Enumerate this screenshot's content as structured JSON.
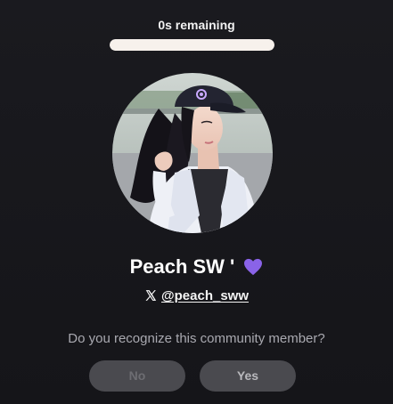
{
  "timer": {
    "label": "0s remaining",
    "progress_fraction": 1.0
  },
  "profile": {
    "display_name": "Peach SW '",
    "name_emoji": "purple-heart-icon",
    "handle": "@peach_sww",
    "handle_icon": "x-logo-icon"
  },
  "prompt": {
    "question": "Do you recognize this community member?"
  },
  "actions": {
    "no_label": "No",
    "yes_label": "Yes"
  },
  "colors": {
    "background": "#17171b",
    "heart": "#8a63e8",
    "button_bg": "#4a4a4f",
    "progress_fill": "#f7f1ec"
  }
}
